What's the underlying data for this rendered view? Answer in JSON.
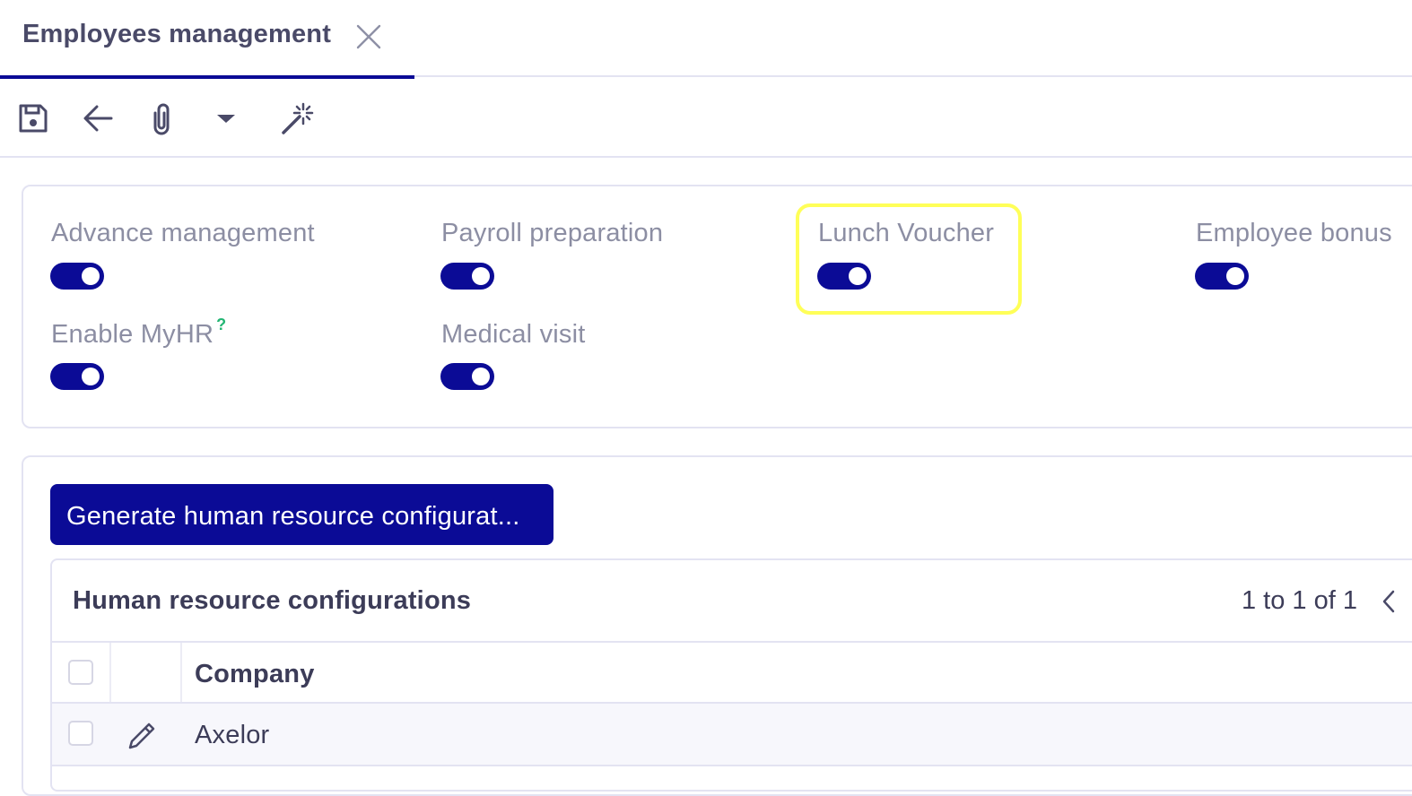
{
  "tab": {
    "title": "Employees management"
  },
  "toolbar": {
    "icons": [
      "save-icon",
      "back-arrow-icon",
      "paperclip-icon",
      "caret-down-icon",
      "magic-wand-icon"
    ]
  },
  "settings": {
    "advance_management": {
      "label": "Advance management",
      "enabled": true
    },
    "payroll_preparation": {
      "label": "Payroll preparation",
      "enabled": true
    },
    "lunch_voucher": {
      "label": "Lunch Voucher",
      "enabled": true
    },
    "employee_bonus": {
      "label": "Employee bonus",
      "enabled": true
    },
    "enable_myhr": {
      "label": "Enable MyHR",
      "help": "?",
      "enabled": true
    },
    "medical_visit": {
      "label": "Medical visit",
      "enabled": true
    }
  },
  "actions": {
    "generate_label": "Generate human resource configurat..."
  },
  "grid": {
    "title": "Human resource configurations",
    "pager": "1 to 1 of 1",
    "columns": [
      "Company"
    ],
    "rows": [
      {
        "company": "Axelor"
      }
    ]
  },
  "colors": {
    "accent": "#0b0b96",
    "highlight": "#ffff58",
    "help": "#22b573"
  }
}
